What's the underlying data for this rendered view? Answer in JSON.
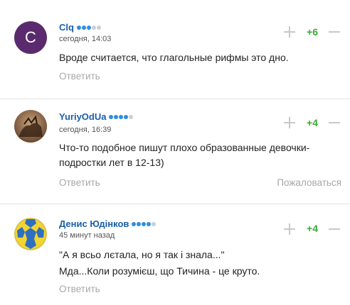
{
  "comments": [
    {
      "avatar_letter": "C",
      "author": "Clq",
      "rating_dots": [
        true,
        true,
        true,
        false,
        false
      ],
      "time": "сегодня, 14:03",
      "text": "Вроде считается, что глагольные рифмы это дно.",
      "score": "+6",
      "reply_label": "Ответить"
    },
    {
      "author": "YuriyOdUa",
      "rating_dots": [
        true,
        true,
        true,
        true,
        false
      ],
      "time": "сегодня, 16:39",
      "text": "Что-то подобное пишут плохо образованные девочки-подростки лет в 12-13)",
      "score": "+4",
      "reply_label": "Ответить",
      "report_label": "Пожаловаться"
    },
    {
      "author": "Денис Юдінков",
      "rating_dots": [
        true,
        true,
        true,
        true,
        false
      ],
      "time": "45 минут назад",
      "text_line1": "\"А я всьо лєтала, но я так і знала...\"",
      "text_line2": "Мда...Коли розумієш, що Тичина - це круто.",
      "score": "+4",
      "reply_label": "Ответить"
    }
  ],
  "colors": {
    "author": "#1a5fa8",
    "score": "#3aaa35",
    "muted": "#a8a8a8",
    "dot_on": "#2d8ee0",
    "dot_off": "#c9cfd6"
  }
}
